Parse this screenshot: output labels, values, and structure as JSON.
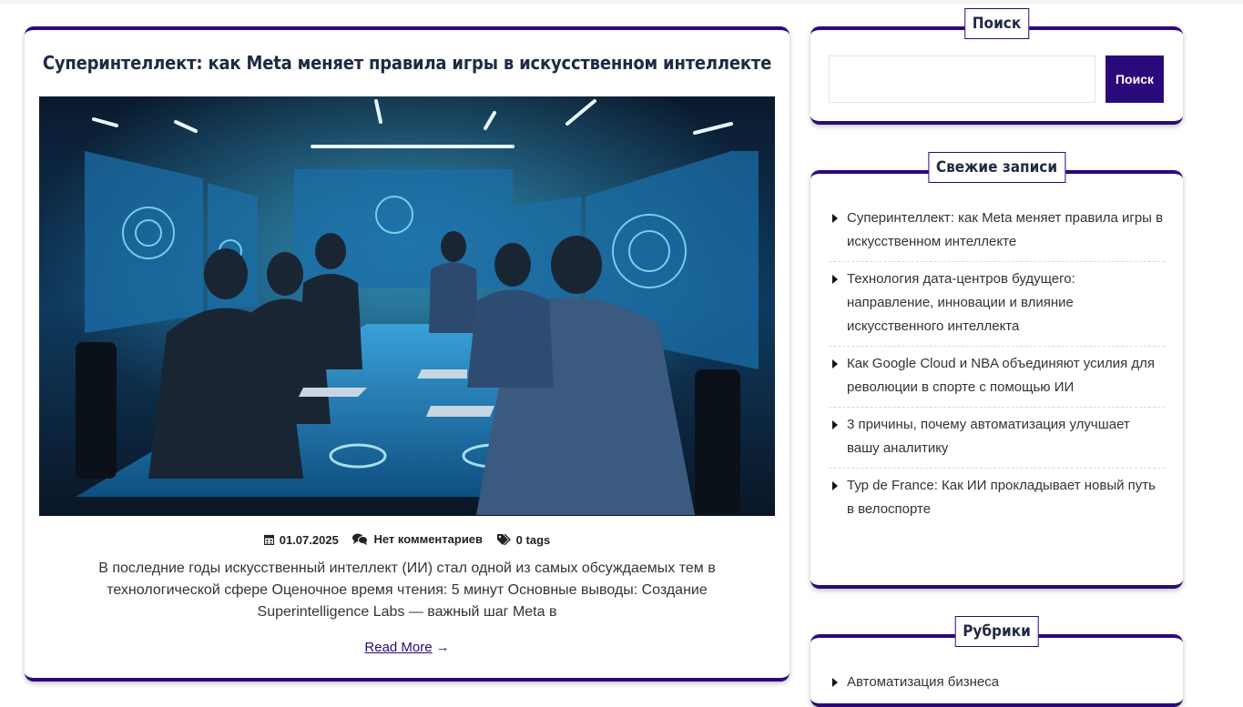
{
  "post": {
    "title": "Суперинтеллект: как Meta меняет правила игры в искусственном интеллекте",
    "date": "01.07.2025",
    "comments": "Нет комментариев",
    "tags": "0 tags",
    "excerpt": "В последние годы искусственный интеллект (ИИ) стал одной из самых обсуждаемых тем в технологической сфере Оценочное время чтения: 5 минут Основные выводы: Создание Superintelligence Labs — важный шаг Meta в",
    "read_more": "Read More",
    "icons": {
      "date": "calendar-icon",
      "comments": "comments-icon",
      "tags": "tags-icon",
      "read_more": "arrow-right-icon"
    }
  },
  "sidebar": {
    "search": {
      "title": "Поиск",
      "input_value": "",
      "button_label": "Поиск"
    },
    "recent": {
      "title": "Свежие записи",
      "items": [
        "Суперинтеллект: как Meta меняет правила игры в искусственном интеллекте",
        "Технология дата-центров будущего: направление, инновации и влияние искусственного интеллекта",
        "Как Google Cloud и NBA объединяют усилия для революции в спорте с помощью ИИ",
        "3 причины, почему автоматизация улучшает вашу аналитику",
        "Тур de France: Как ИИ прокладывает новый путь в велоспорте"
      ]
    },
    "categories": {
      "title": "Рубрики",
      "items": [
        "Автоматизация бизнеса"
      ]
    }
  },
  "colors": {
    "accent": "#2a0a7a",
    "title_text": "#1f2a44"
  }
}
